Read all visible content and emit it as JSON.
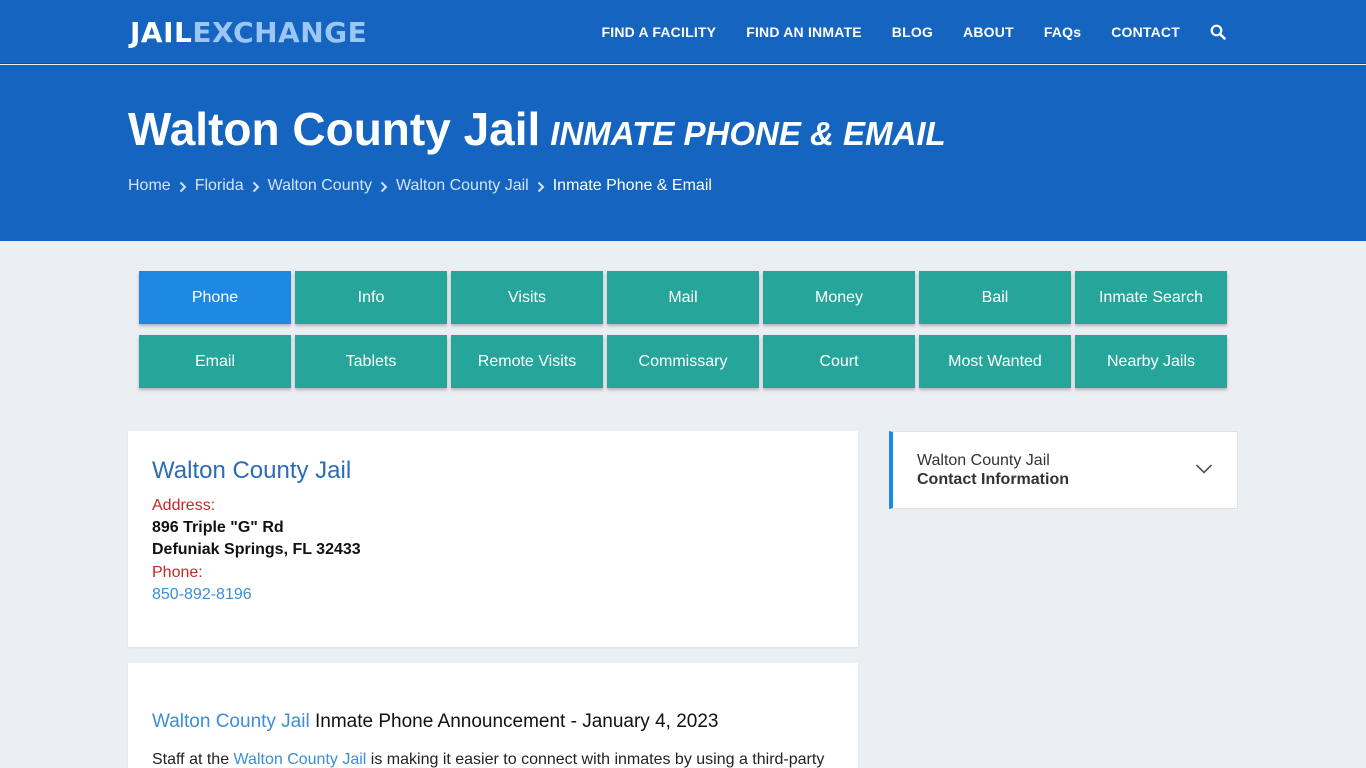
{
  "logo": {
    "part1": "JAIL",
    "part2": "EXCHANGE"
  },
  "nav": {
    "items": [
      "FIND A FACILITY",
      "FIND AN INMATE",
      "BLOG",
      "ABOUT",
      "FAQs",
      "CONTACT"
    ],
    "search_icon": "search-icon"
  },
  "hero": {
    "title": "Walton County Jail",
    "subtitle": "INMATE PHONE & EMAIL",
    "breadcrumbs": [
      "Home",
      "Florida",
      "Walton County",
      "Walton County Jail",
      "Inmate Phone & Email"
    ]
  },
  "tabs": {
    "row1": [
      "Phone",
      "Info",
      "Visits",
      "Mail",
      "Money",
      "Bail",
      "Inmate Search"
    ],
    "row2": [
      "Email",
      "Tablets",
      "Remote Visits",
      "Commissary",
      "Court",
      "Most Wanted",
      "Nearby Jails"
    ],
    "active": "Phone"
  },
  "facility": {
    "name": "Walton County Jail",
    "address_label": "Address:",
    "address_line1": "896 Triple \"G\" Rd",
    "address_line2": "Defuniak Springs, FL 32433",
    "phone_label": "Phone:",
    "phone": "850-892-8196"
  },
  "announcement": {
    "link": "Walton County Jail",
    "title_rest": " Inmate Phone Announcement - January 4, 2023",
    "para_start": "Staff at the ",
    "para_link": "Walton County Jail",
    "para_rest": " is making it easier to connect with inmates by using a third-party"
  },
  "sidebar": {
    "line1": "Walton County Jail",
    "line2": "Contact Information"
  },
  "colors": {
    "brand_blue": "#1565c0",
    "tab_teal": "#26a69a",
    "tab_active": "#1e88e5",
    "label_red": "#c62828",
    "link_blue": "#3c8ed6"
  }
}
